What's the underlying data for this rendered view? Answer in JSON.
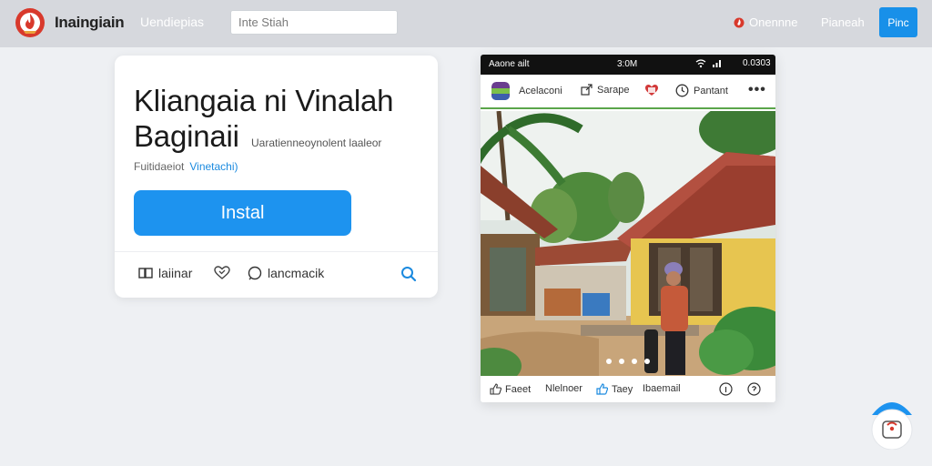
{
  "header": {
    "brand": "Inaingiain",
    "nav_link": "Uendiepias",
    "search_placeholder": "Inte Stiah",
    "right_link_1": "Onennne",
    "right_link_2": "Pianeah",
    "top_button": "Pinc"
  },
  "card": {
    "title_line_1": "Kliangaia ni Vinalah",
    "title_line_2": "Baginaii",
    "subtitle": "Uaratienneoynolent laaleor",
    "meta_text": "Fuitidaeiot",
    "meta_link": "Vinetachi)",
    "install_label": "Instal",
    "action_1": "laiinar",
    "action_3": "lancmacik"
  },
  "phone": {
    "status_left": "Aaone ailt",
    "status_time": "3:0M",
    "status_battery": "0.0303",
    "toolbar": {
      "app_name": "Acelaconi",
      "share": "Sarape",
      "settings": "Pantant",
      "more": "•••"
    },
    "footer": {
      "like": "Faeet",
      "comment": "Nlelnoer",
      "share": "Taey",
      "save": "Ibaemail"
    }
  },
  "colors": {
    "accent": "#1d93ef",
    "topbar": "#d6d8dd",
    "background": "#eef0f3",
    "brand_red": "#d8392c"
  },
  "icons": {
    "brand": "flame-logo-icon",
    "card_search": "search-icon",
    "heart": "heart-icon",
    "chat": "chat-bubble-icon"
  }
}
